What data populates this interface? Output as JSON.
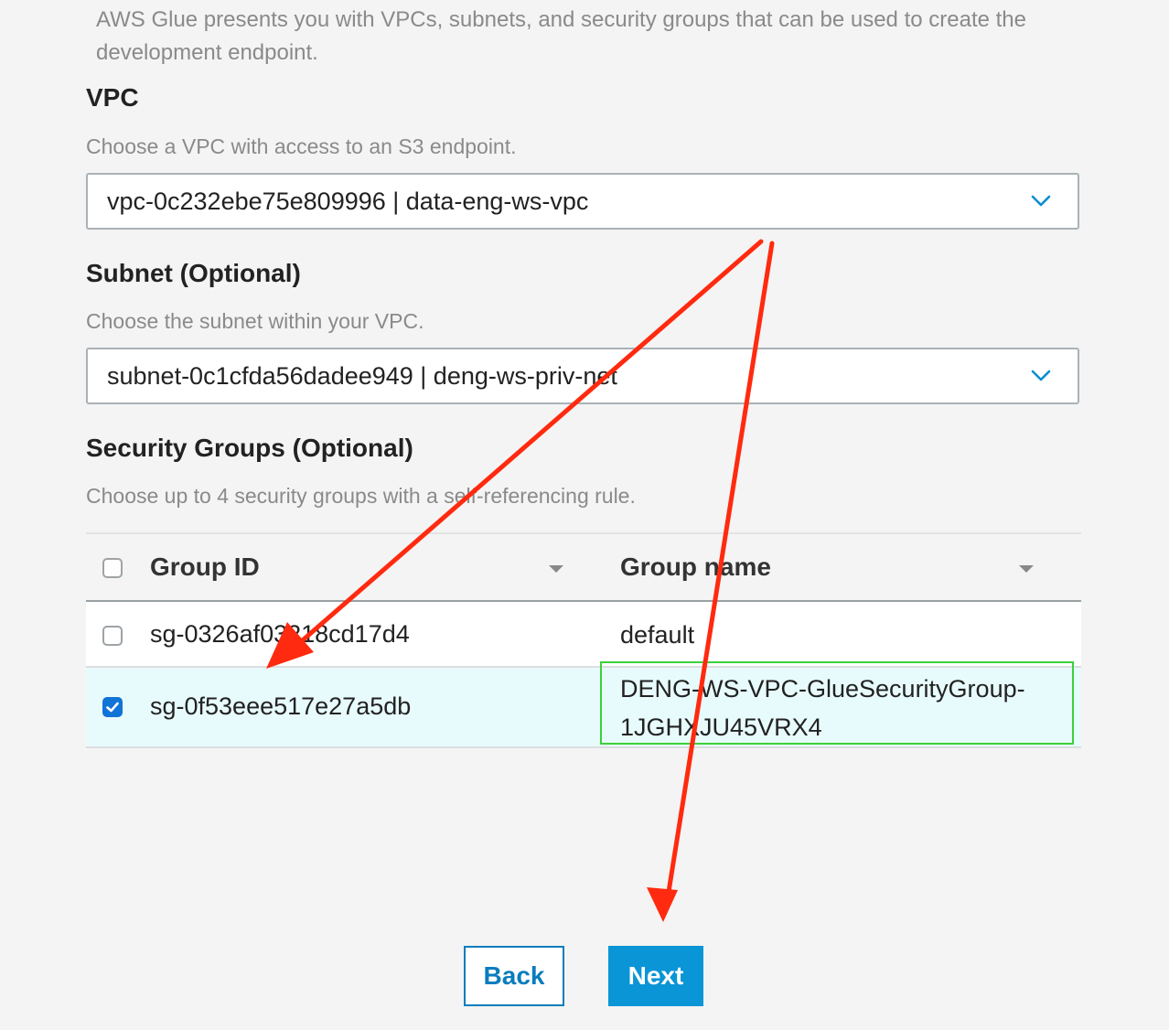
{
  "intro_text": "AWS Glue presents you with VPCs, subnets, and security groups that can be used to create the development endpoint.",
  "vpc": {
    "label": "VPC",
    "help": "Choose a VPC with access to an S3 endpoint.",
    "selected": "vpc-0c232ebe75e809996 | data-eng-ws-vpc"
  },
  "subnet": {
    "label": "Subnet (Optional)",
    "help": "Choose the subnet within your VPC.",
    "selected": "subnet-0c1cfda56dadee949 | deng-ws-priv-net"
  },
  "security_groups": {
    "label": "Security Groups (Optional)",
    "help": "Choose up to 4 security groups with a self-referencing rule.",
    "columns": [
      "Group ID",
      "Group name"
    ],
    "rows": [
      {
        "id": "sg-0326af03218cd17d4",
        "name_line1": "default",
        "name_line2": "",
        "checked": false
      },
      {
        "id": "sg-0f53eee517e27a5db",
        "name_line1": "DENG-WS-VPC-GlueSecurityGroup-",
        "name_line2": "1JGHXJU45VRX4",
        "checked": true
      }
    ]
  },
  "buttons": {
    "back": "Back",
    "next": "Next"
  },
  "colors": {
    "accent": "#0a95d6",
    "annotation_arrow": "#ff2a0f",
    "annotation_box": "#3bd13b",
    "selected_row": "#e8fbfc"
  },
  "icons": {
    "select_chevron": "chevron-down-icon",
    "sort": "caret-down-icon",
    "checkbox_checked": "checkmark-icon"
  }
}
